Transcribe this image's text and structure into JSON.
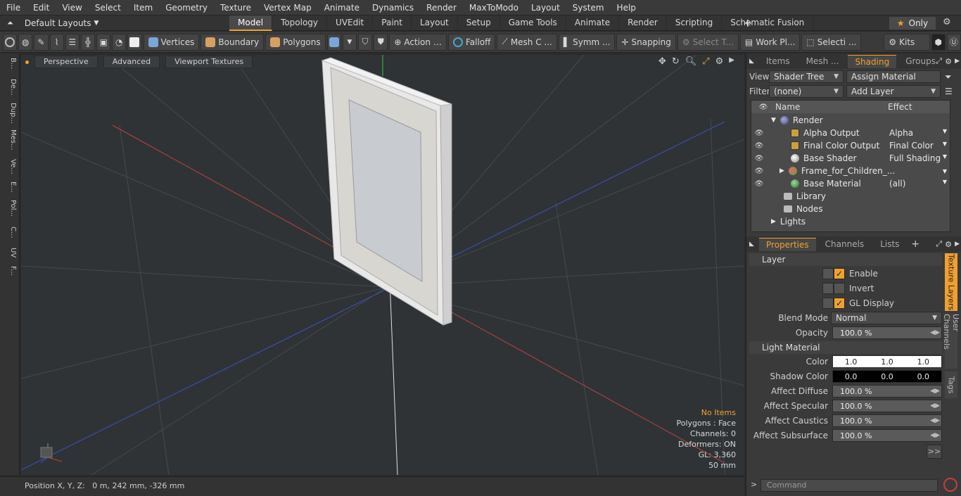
{
  "menu": [
    "File",
    "Edit",
    "View",
    "Select",
    "Item",
    "Geometry",
    "Texture",
    "Vertex Map",
    "Animate",
    "Dynamics",
    "Render",
    "MaxToModo",
    "Layout",
    "System",
    "Help"
  ],
  "layouts_label": "Default Layouts",
  "tabs": [
    "Model",
    "Topology",
    "UVEdit",
    "Paint",
    "Layout",
    "Setup",
    "Game Tools",
    "Animate",
    "Render",
    "Scripting",
    "Schematic Fusion"
  ],
  "only_label": "Only",
  "toolbar": {
    "vertices": "Vertices",
    "boundary": "Boundary",
    "polygons": "Polygons",
    "action": "Action",
    "falloff": "Falloff",
    "mesh": "Mesh C ...",
    "symm": "Symm ...",
    "snapping": "Snapping",
    "select": "Select T...",
    "workplane": "Work Pl...",
    "selecti": "Selecti ...",
    "kits": "Kits"
  },
  "left_tabs": [
    "B...",
    "De...",
    "Dup...",
    "Mes...",
    "Ve...",
    "E...",
    "Pol...",
    "C...",
    "UV",
    "F..."
  ],
  "viewport": {
    "buttons": [
      "Perspective",
      "Advanced",
      "Viewport Textures"
    ],
    "stats": {
      "no_items": "No Items",
      "polygons": "Polygons : Face",
      "channels": "Channels: 0",
      "deformers": "Deformers: ON",
      "gl": "GL: 3,360",
      "scale": "50 mm"
    }
  },
  "status": "Position X, Y, Z:   0 m, 242 mm, -326 mm",
  "shading": {
    "tabs": [
      "Items",
      "Mesh ...",
      "Shading",
      "Groups"
    ],
    "view_label": "View",
    "view_value": "Shader Tree",
    "assign": "Assign Material",
    "filter_label": "Filter",
    "filter_value": "(none)",
    "add_layer": "Add Layer",
    "col_name": "Name",
    "col_effect": "Effect",
    "rows": [
      {
        "name": "Render",
        "effect": ""
      },
      {
        "name": "Alpha Output",
        "effect": "Alpha"
      },
      {
        "name": "Final Color Output",
        "effect": "Final Color"
      },
      {
        "name": "Base Shader",
        "effect": "Full Shading"
      },
      {
        "name": "Frame_for_Children_...",
        "effect": ""
      },
      {
        "name": "Base Material",
        "effect": "(all)"
      },
      {
        "name": "Library",
        "effect": ""
      },
      {
        "name": "Nodes",
        "effect": ""
      },
      {
        "name": "Lights",
        "effect": ""
      }
    ]
  },
  "properties": {
    "tabs": [
      "Properties",
      "Channels",
      "Lists"
    ],
    "layer_section": "Layer",
    "enable": "Enable",
    "invert": "Invert",
    "gl_display": "GL Display",
    "blend_mode_label": "Blend Mode",
    "blend_mode_value": "Normal",
    "opacity_label": "Opacity",
    "opacity_value": "100.0 %",
    "light_section": "Light Material",
    "color_label": "Color",
    "color_values": [
      "1.0",
      "1.0",
      "1.0"
    ],
    "shadow_label": "Shadow Color",
    "shadow_values": [
      "0.0",
      "0.0",
      "0.0"
    ],
    "affect_diffuse_label": "Affect Diffuse",
    "affect_diffuse": "100.0 %",
    "affect_specular_label": "Affect Specular",
    "affect_specular": "100.0 %",
    "affect_caustics_label": "Affect Caustics",
    "affect_caustics": "100.0 %",
    "affect_subsurface_label": "Affect Subsurface",
    "affect_subsurface": "100.0 %",
    "side_tabs": [
      "Texture Layers",
      "User Channels",
      "Tags"
    ]
  },
  "command_placeholder": "Command",
  "colors": {
    "accent": "#f0a030",
    "x_axis": "#c04040",
    "z_axis": "#4050c0"
  }
}
